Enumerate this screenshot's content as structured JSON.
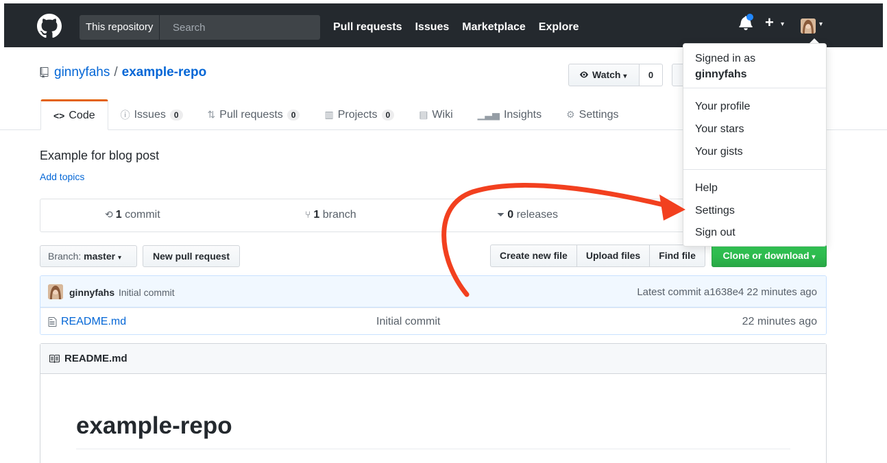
{
  "header": {
    "search_scope": "This repository",
    "search_placeholder": "Search",
    "nav": [
      "Pull requests",
      "Issues",
      "Marketplace",
      "Explore"
    ],
    "accent_color": "#24292e",
    "notification_color": "#2188ff"
  },
  "repo": {
    "owner": "ginnyfahs",
    "separator": "/",
    "name": "example-repo",
    "watch_label": "Watch",
    "watch_count": "0",
    "description": "Example for blog post",
    "add_topics": "Add topics"
  },
  "tabs": [
    {
      "label": "Code",
      "icon": "<>",
      "count": null
    },
    {
      "label": "Issues",
      "icon": "issue-icon",
      "count": "0"
    },
    {
      "label": "Pull requests",
      "icon": "pr-icon",
      "count": "0"
    },
    {
      "label": "Projects",
      "icon": "project-icon",
      "count": "0"
    },
    {
      "label": "Wiki",
      "icon": "wiki-icon",
      "count": null
    },
    {
      "label": "Insights",
      "icon": "graph-icon",
      "count": null
    },
    {
      "label": "Settings",
      "icon": "gear-icon",
      "count": null
    }
  ],
  "summary": {
    "commits_num": "1",
    "commits_label": "commit",
    "branches_num": "1",
    "branches_label": "branch",
    "releases_num": "0",
    "releases_label": "releases"
  },
  "file_nav": {
    "branch_prefix": "Branch:",
    "branch_name": "master",
    "new_pr": "New pull request",
    "create_file": "Create new file",
    "upload_files": "Upload files",
    "find_file": "Find file",
    "clone": "Clone or download",
    "clone_color": "#28a745"
  },
  "commit": {
    "author": "ginnyfahs",
    "message": "Initial commit",
    "latest": "Latest commit a1638e4 22 minutes ago"
  },
  "files": [
    {
      "name": "README.md",
      "message": "Initial commit",
      "age": "22 minutes ago"
    }
  ],
  "readme": {
    "title": "README.md",
    "heading": "example-repo"
  },
  "dropdown": {
    "signed_in_as": "Signed in as",
    "username": "ginnyfahs",
    "items_group1": [
      "Your profile",
      "Your stars",
      "Your gists"
    ],
    "items_group2": [
      "Help",
      "Settings",
      "Sign out"
    ]
  },
  "annotation": {
    "arrow_color": "#f2401f",
    "points_to": "Settings"
  }
}
